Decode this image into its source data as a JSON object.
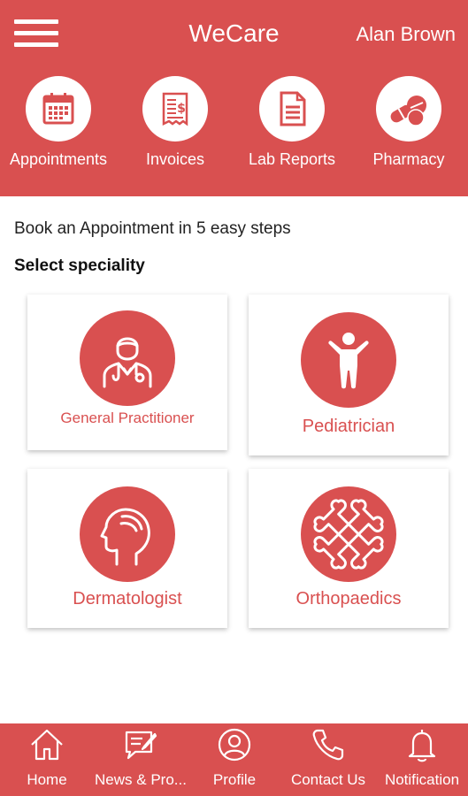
{
  "header": {
    "title": "WeCare",
    "user_name": "Alan Brown"
  },
  "quick_actions": [
    {
      "label": "Appointments",
      "icon": "calendar-icon"
    },
    {
      "label": "Invoices",
      "icon": "receipt-icon"
    },
    {
      "label": "Lab Reports",
      "icon": "document-icon"
    },
    {
      "label": "Pharmacy",
      "icon": "pills-icon"
    }
  ],
  "main": {
    "intro": "Book an Appointment in 5 easy steps",
    "section_title": "Select speciality",
    "specialities": [
      {
        "label": "General Practitioner",
        "icon": "doctor-icon"
      },
      {
        "label": "Pediatrician",
        "icon": "child-icon"
      },
      {
        "label": "Dermatologist",
        "icon": "head-profile-icon"
      },
      {
        "label": "Orthopaedics",
        "icon": "crossed-bones-icon"
      }
    ]
  },
  "bottom_nav": [
    {
      "label": "Home",
      "icon": "home-icon"
    },
    {
      "label": "News & Pro...",
      "icon": "news-icon"
    },
    {
      "label": "Profile",
      "icon": "profile-icon"
    },
    {
      "label": "Contact Us",
      "icon": "phone-icon"
    },
    {
      "label": "Notification",
      "icon": "bell-icon"
    }
  ],
  "colors": {
    "brand": "#d95050",
    "background": "#ffffff"
  }
}
